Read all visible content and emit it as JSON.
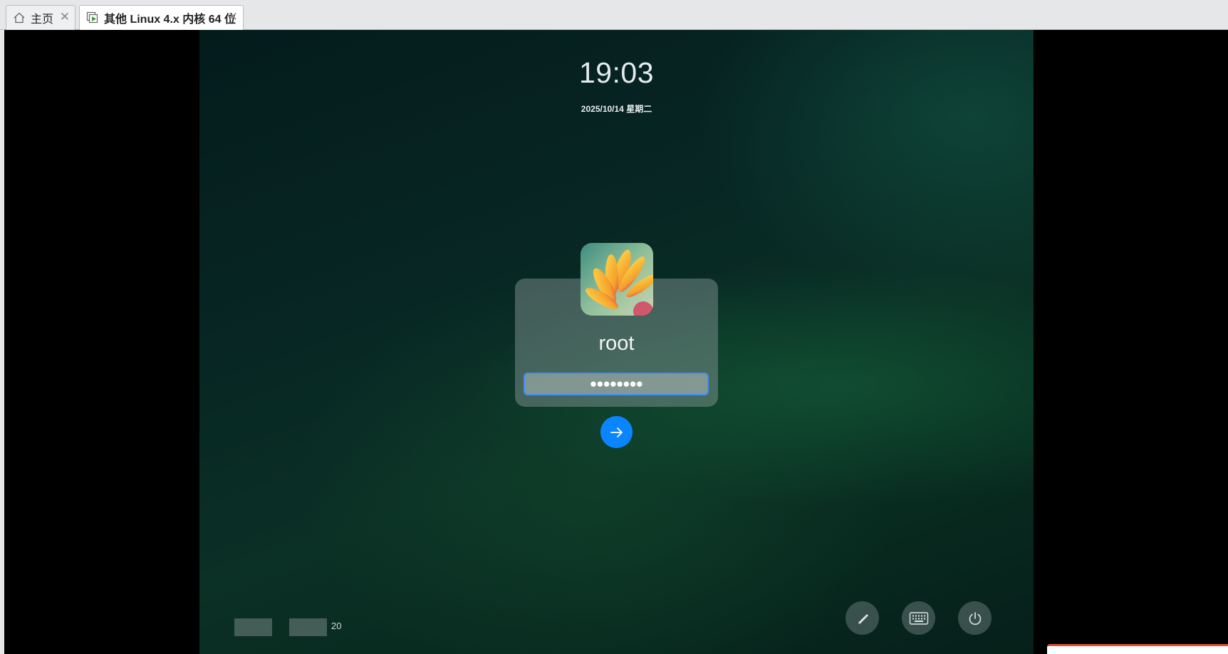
{
  "tabs": [
    {
      "label": "主页",
      "icon": "home-icon",
      "close": "✕"
    },
    {
      "label": "其他 Linux 4.x 内核 64 位",
      "icon": "vm-play-icon",
      "close": "✕"
    }
  ],
  "lockscreen": {
    "time": "19:03",
    "date": "2025/10/14 星期二",
    "username": "root",
    "password_mask": "●●●●●●●●",
    "submit_icon": "arrow-right-icon"
  },
  "bottom_bar": {
    "tray_text": "20",
    "buttons": [
      {
        "name": "input-method-icon"
      },
      {
        "name": "keyboard-icon"
      },
      {
        "name": "power-icon"
      }
    ]
  },
  "colors": {
    "accent": "#0a84ff",
    "focus_border": "#3f8fff",
    "background": "#072624"
  }
}
